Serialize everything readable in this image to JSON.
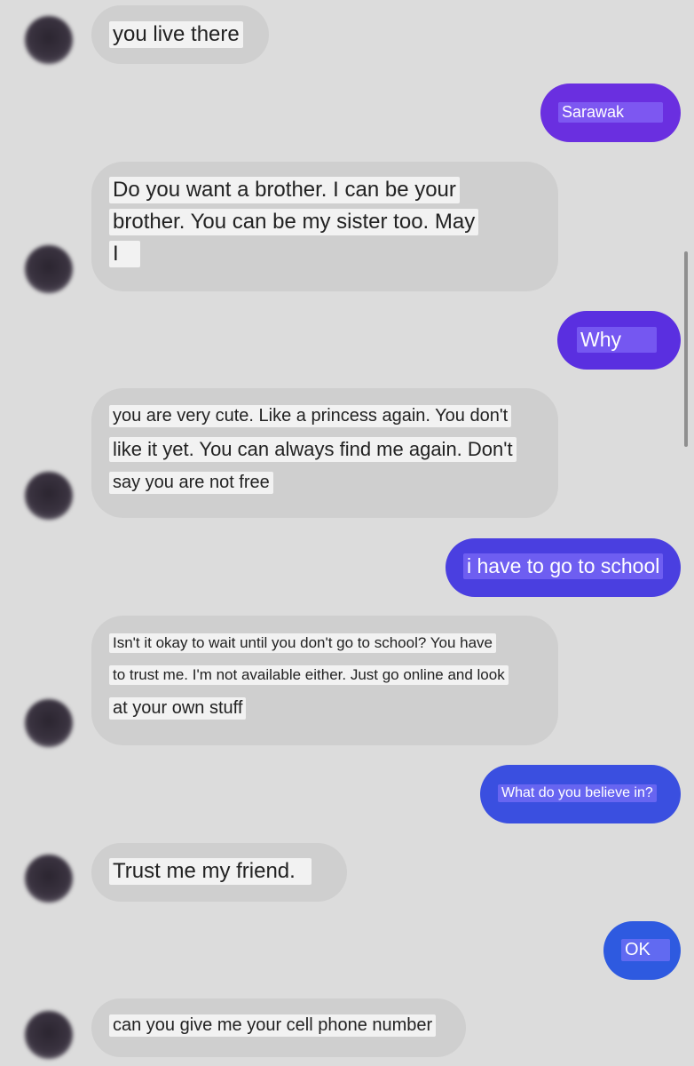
{
  "messages": [
    {
      "sender": "them",
      "lines": [
        "you live there"
      ]
    },
    {
      "sender": "me",
      "lines": [
        "Sarawak"
      ],
      "color": "#6a2fe0"
    },
    {
      "sender": "them",
      "lines": [
        "Do you want a brother. I can be your",
        "brother. You can be my sister too. May",
        "I"
      ]
    },
    {
      "sender": "me",
      "lines": [
        "Why"
      ],
      "color": "#5a2fe0"
    },
    {
      "sender": "them",
      "lines": [
        "you are very cute. Like a princess again. You don't",
        "like it yet. You can always find me again. Don't",
        "say you are not free"
      ]
    },
    {
      "sender": "me",
      "lines": [
        "i have to go to school"
      ],
      "color": "#4a3fe0"
    },
    {
      "sender": "them",
      "lines": [
        "Isn't it okay to wait until you don't go to school? You have",
        "to trust me. I'm not available either. Just go online and look",
        "at your own stuff"
      ]
    },
    {
      "sender": "me",
      "lines": [
        "What do you believe in?"
      ],
      "color": "#3a4fe0"
    },
    {
      "sender": "them",
      "lines": [
        "Trust me my friend."
      ]
    },
    {
      "sender": "me",
      "lines": [
        "OK"
      ],
      "color": "#2e5ae0"
    },
    {
      "sender": "them",
      "lines": [
        "can you give me your cell phone number"
      ]
    }
  ],
  "colors": {
    "background": "#dcdcdc",
    "incoming_bubble": "#cfcfcf"
  }
}
